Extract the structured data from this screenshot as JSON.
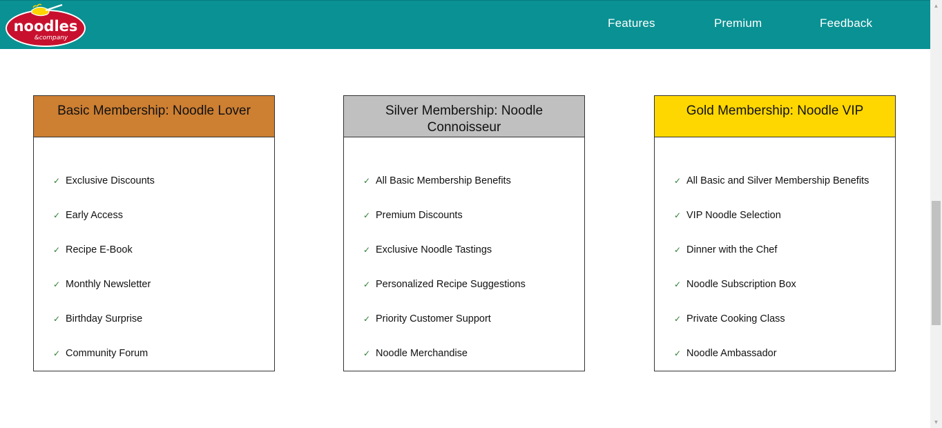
{
  "brand": {
    "logo_word": "noodles",
    "logo_sub": "&company",
    "colors": {
      "nav": "#0a9193",
      "logo_red": "#c8102e",
      "logo_yellow": "#ffd400"
    }
  },
  "nav": {
    "links": [
      "Features",
      "Premium",
      "Feedback"
    ]
  },
  "cards": [
    {
      "title": "Basic Membership: Noodle Lover",
      "color": "#cd7f32",
      "features": [
        "Exclusive Discounts",
        "Early Access",
        "Recipe E-Book",
        "Monthly Newsletter",
        "Birthday Surprise",
        "Community Forum"
      ]
    },
    {
      "title": "Silver Membership: Noodle Connoisseur",
      "color": "#c0c0c0",
      "features": [
        "All Basic Membership Benefits",
        "Premium Discounts",
        "Exclusive Noodle Tastings",
        "Personalized Recipe Suggestions",
        "Priority Customer Support",
        "Noodle Merchandise"
      ]
    },
    {
      "title": "Gold Membership: Noodle VIP",
      "color": "#ffd700",
      "features": [
        "All Basic and Silver Membership Benefits",
        "VIP Noodle Selection",
        "Dinner with the Chef",
        "Noodle Subscription Box",
        "Private Cooking Class",
        "Noodle Ambassador"
      ]
    }
  ],
  "check_glyph": "✓"
}
